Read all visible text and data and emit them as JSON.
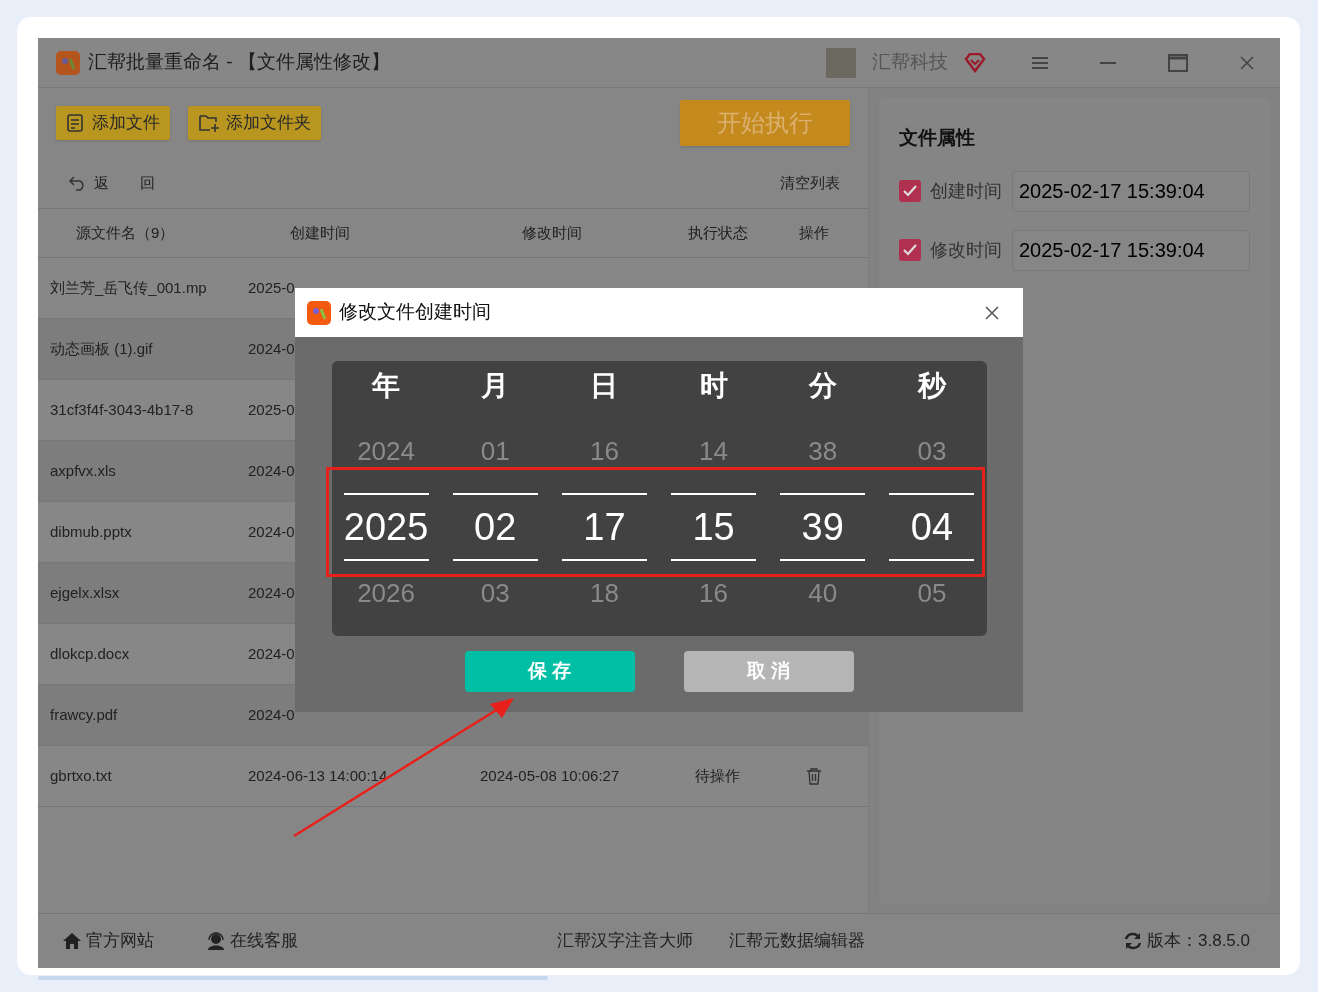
{
  "window": {
    "title": "汇帮批量重命名 - 【文件属性修改】",
    "user": "汇帮科技"
  },
  "toolbar": {
    "buttons": [
      {
        "kind": "file",
        "label": "添加文件"
      },
      {
        "kind": "folder",
        "label": "添加文件夹"
      }
    ],
    "start": "开始执行",
    "back": "返　回",
    "clear": "清空列表"
  },
  "table": {
    "columns": [
      "源文件名（9）",
      "创建时间",
      "修改时间",
      "执行状态",
      "操作"
    ],
    "rows": [
      {
        "name": "刘兰芳_岳飞传_001.mp",
        "created": "2025-0"
      },
      {
        "name": "动态画板 (1).gif",
        "created": "2024-0"
      },
      {
        "name": "31cf3f4f-3043-4b17-8",
        "created": "2025-0"
      },
      {
        "name": "axpfvx.xls",
        "created": "2024-0"
      },
      {
        "name": "dibmub.pptx",
        "created": "2024-0"
      },
      {
        "name": "ejgelx.xlsx",
        "created": "2024-0"
      },
      {
        "name": "dlokcp.docx",
        "created": "2024-0"
      },
      {
        "name": "frawcy.pdf",
        "created": "2024-0"
      },
      {
        "name": "gbrtxo.txt",
        "created": "2024-06-13 14:00:14",
        "modified": "2024-05-08 10:06:27",
        "status": "待操作"
      }
    ]
  },
  "properties": {
    "title": "文件属性",
    "items": [
      {
        "label": "创建时间",
        "checked": true,
        "value": "2025-02-17 15:39:04"
      },
      {
        "label": "修改时间",
        "checked": true,
        "value": "2025-02-17 15:39:04"
      }
    ]
  },
  "dialog": {
    "title": "修改文件创建时间",
    "columns": [
      {
        "label": "年",
        "prev": "2024",
        "value": "2025",
        "next": "2026"
      },
      {
        "label": "月",
        "prev": "01",
        "value": "02",
        "next": "03"
      },
      {
        "label": "日",
        "prev": "16",
        "value": "17",
        "next": "18"
      },
      {
        "label": "时",
        "prev": "14",
        "value": "15",
        "next": "16"
      },
      {
        "label": "分",
        "prev": "38",
        "value": "39",
        "next": "40"
      },
      {
        "label": "秒",
        "prev": "03",
        "value": "04",
        "next": "05"
      }
    ],
    "buttons": [
      {
        "kind": "save",
        "label": "保 存"
      },
      {
        "kind": "cancel",
        "label": "取 消"
      }
    ]
  },
  "status_bar": {
    "left": [
      {
        "kind": "home",
        "label": "官方网站"
      },
      {
        "kind": "support",
        "label": "在线客服"
      }
    ],
    "center": [
      "汇帮汉字注音大师",
      "汇帮元数据编辑器"
    ],
    "version": "版本：3.8.5.0"
  }
}
